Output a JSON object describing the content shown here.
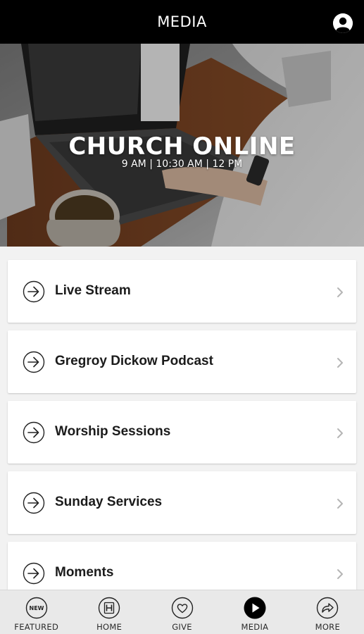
{
  "header": {
    "title": "MEDIA",
    "profile_icon": "user-icon"
  },
  "hero": {
    "title": "CHURCH ONLINE",
    "subtitle": "9 AM | 10:30 AM | 12 PM"
  },
  "list": {
    "items": [
      {
        "label": "Live Stream",
        "icon": "arrow-circle-icon"
      },
      {
        "label": "Gregroy Dickow Podcast",
        "icon": "arrow-circle-icon"
      },
      {
        "label": "Worship Sessions",
        "icon": "arrow-circle-icon"
      },
      {
        "label": "Sunday Services",
        "icon": "arrow-circle-icon"
      },
      {
        "label": "Moments",
        "icon": "arrow-circle-icon"
      }
    ]
  },
  "tabbar": {
    "tabs": [
      {
        "label": "FEATURED",
        "icon": "new-badge-icon",
        "badge_text": "NEW",
        "active": false
      },
      {
        "label": "HOME",
        "icon": "home-h-icon",
        "badge_text": "H",
        "active": false
      },
      {
        "label": "GIVE",
        "icon": "heart-icon",
        "active": false
      },
      {
        "label": "MEDIA",
        "icon": "play-icon",
        "active": true
      },
      {
        "label": "MORE",
        "icon": "share-arrow-icon",
        "active": false
      }
    ]
  },
  "colors": {
    "header_bg": "#000000",
    "page_bg": "#f2f2f2",
    "card_bg": "#ffffff",
    "tabbar_bg": "#e9e9e9",
    "text": "#1b1b1b"
  }
}
